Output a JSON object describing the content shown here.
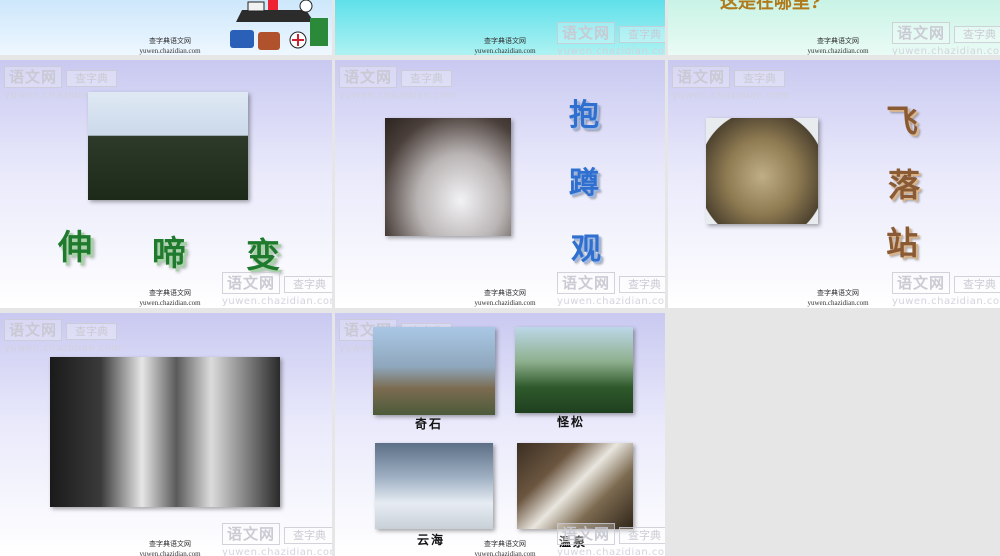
{
  "watermark": {
    "brand": "语文网",
    "box": "查字典",
    "url": "yuwen.chazidian.com"
  },
  "footer": {
    "line1": "查字典语文网",
    "line2": "yuwen.chazidian.com"
  },
  "top_row": {
    "slide3_partial_text": "这是在哪里?"
  },
  "slide4": {
    "words": [
      "伸",
      "啼",
      "变"
    ]
  },
  "slide5": {
    "words": [
      "抱",
      "蹲",
      "观"
    ]
  },
  "slide6": {
    "words": [
      "飞",
      "落",
      "站"
    ]
  },
  "slide8": {
    "captions": [
      "奇石",
      "怪松",
      "云海",
      "温泉"
    ]
  },
  "colors": {
    "lavender": "#c9c9f1",
    "cyan": "#5fe0ea",
    "mint": "#c9f3e6",
    "gray": "#e6e6e6"
  }
}
